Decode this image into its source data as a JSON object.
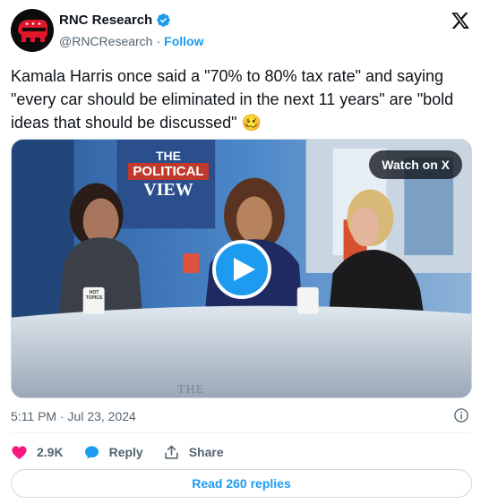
{
  "author": {
    "display_name": "RNC Research",
    "handle": "@RNCResearch",
    "separator": "·",
    "follow_label": "Follow",
    "verified": true
  },
  "tweet": {
    "text": "Kamala Harris once said a \"70% to 80% tax rate\" and saying \"every car should be eliminated in the next 11 years\" are \"bold ideas that should be discussed\" 🥴",
    "timestamp": "5:11 PM · Jul 23, 2024"
  },
  "media": {
    "watch_label": "Watch on X",
    "backdrop_title_line1": "THE",
    "backdrop_title_line2": "POLITICAL",
    "backdrop_title_line3": "VIEW",
    "desk_text": "THE",
    "mug_text": "HOT TOPICS"
  },
  "actions": {
    "like_count": "2.9K",
    "reply_label": "Reply",
    "share_label": "Share"
  },
  "read_replies_label": "Read 260 replies",
  "colors": {
    "accent": "#1d9bf0",
    "like": "#f91880",
    "text_primary": "#0f1419",
    "text_secondary": "#536471"
  },
  "icons": [
    "rnc-elephant-logo",
    "verified-badge-icon",
    "x-logo-icon",
    "play-icon",
    "info-icon",
    "heart-icon",
    "reply-bubble-icon",
    "share-icon"
  ]
}
